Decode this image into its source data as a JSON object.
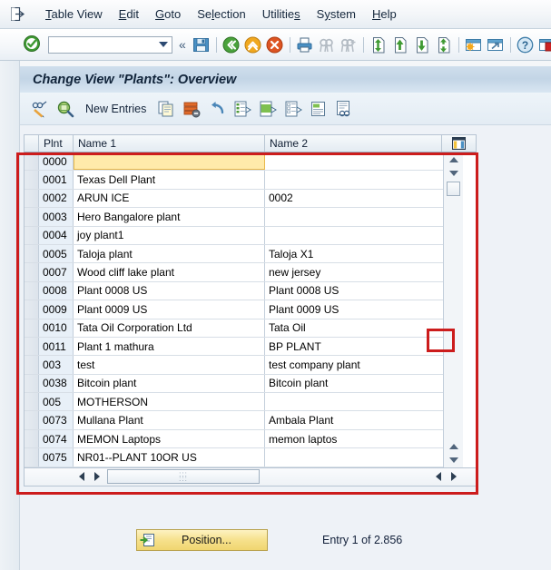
{
  "menu": {
    "system_icon": "window-system-menu-icon",
    "items": [
      {
        "label": "Table View",
        "accel": "T",
        "name": "menu-table-view"
      },
      {
        "label": "Edit",
        "accel": "E",
        "name": "menu-edit"
      },
      {
        "label": "Goto",
        "accel": "G",
        "name": "menu-goto"
      },
      {
        "label": "Selection",
        "accel": "l",
        "name": "menu-selection"
      },
      {
        "label": "Utilities",
        "accel": "s",
        "name": "menu-utilities"
      },
      {
        "label": "System",
        "accel": "y",
        "name": "menu-system"
      },
      {
        "label": "Help",
        "accel": "H",
        "name": "menu-help"
      }
    ]
  },
  "toolbar": {
    "enter_icon": "enter-check-icon",
    "command_field_value": "",
    "command_field_placeholder": "",
    "expand_icon": "expand-command-field-icon",
    "buttons": [
      {
        "name": "save-icon",
        "title": "Save"
      },
      {
        "name": "back-icon",
        "title": "Back"
      },
      {
        "name": "exit-icon",
        "title": "Exit"
      },
      {
        "name": "cancel-icon",
        "title": "Cancel"
      },
      {
        "name": "print-icon",
        "title": "Print"
      },
      {
        "name": "find-icon",
        "title": "Find"
      },
      {
        "name": "find-next-icon",
        "title": "Find Next"
      },
      {
        "name": "first-page-icon",
        "title": "First Page"
      },
      {
        "name": "previous-page-icon",
        "title": "Previous Page"
      },
      {
        "name": "next-page-icon",
        "title": "Next Page"
      },
      {
        "name": "last-page-icon",
        "title": "Last Page"
      },
      {
        "name": "create-session-icon",
        "title": "Create New Session"
      },
      {
        "name": "create-shortcut-icon",
        "title": "Create Shortcut"
      },
      {
        "name": "help-icon",
        "title": "Help"
      },
      {
        "name": "customize-layout-icon",
        "title": "Customize Local Layout"
      }
    ]
  },
  "title": "Change View \"Plants\": Overview",
  "app_toolbar": {
    "new_entries_label": "New Entries",
    "buttons": [
      {
        "name": "display-change-icon",
        "title": "Display/Change"
      },
      {
        "name": "details-magnifier-icon",
        "title": "Details"
      },
      {
        "name": "copy-as-icon",
        "title": "Copy As..."
      },
      {
        "name": "delete-row-icon",
        "title": "Delete"
      },
      {
        "name": "undo-icon",
        "title": "Undo Change"
      },
      {
        "name": "select-all-icon",
        "title": "Select All"
      },
      {
        "name": "select-block-icon",
        "title": "Select Block"
      },
      {
        "name": "deselect-all-icon",
        "title": "Deselect All"
      },
      {
        "name": "variable-list-icon",
        "title": "Variable List"
      },
      {
        "name": "display-detail-icon",
        "title": "Display Detail"
      }
    ]
  },
  "grid": {
    "columns": [
      {
        "key": "plnt",
        "label": "Plnt"
      },
      {
        "key": "name1",
        "label": "Name 1"
      },
      {
        "key": "name2",
        "label": "Name 2"
      }
    ],
    "config_icon": "table-settings-icon",
    "rows": [
      {
        "plnt": "0000",
        "name1": "",
        "name2": "",
        "selected": true
      },
      {
        "plnt": "0001",
        "name1": "Texas Dell Plant",
        "name2": ""
      },
      {
        "plnt": "0002",
        "name1": "ARUN ICE",
        "name2": "0002"
      },
      {
        "plnt": "0003",
        "name1": "Hero Bangalore plant",
        "name2": ""
      },
      {
        "plnt": "0004",
        "name1": "joy plant1",
        "name2": ""
      },
      {
        "plnt": "0005",
        "name1": "Taloja plant",
        "name2": "Taloja X1"
      },
      {
        "plnt": "0007",
        "name1": "Wood cliff lake plant",
        "name2": "new jersey"
      },
      {
        "plnt": "0008",
        "name1": "Plant 0008 US",
        "name2": "Plant 0008 US"
      },
      {
        "plnt": "0009",
        "name1": "Plant 0009 US",
        "name2": "Plant 0009 US"
      },
      {
        "plnt": "0010",
        "name1": "Tata Oil Corporation Ltd",
        "name2": "Tata Oil"
      },
      {
        "plnt": "0011",
        "name1": "Plant 1 mathura",
        "name2": "BP PLANT"
      },
      {
        "plnt": "003",
        "name1": "test",
        "name2": "test company plant"
      },
      {
        "plnt": "0038",
        "name1": "Bitcoin plant",
        "name2": "Bitcoin plant"
      },
      {
        "plnt": "005",
        "name1": "MOTHERSON",
        "name2": ""
      },
      {
        "plnt": "0073",
        "name1": "Mullana Plant",
        "name2": "Ambala Plant"
      },
      {
        "plnt": "0074",
        "name1": "MEMON Laptops",
        "name2": "memon laptos"
      },
      {
        "plnt": "0075",
        "name1": "NR01--PLANT 10OR US",
        "name2": ""
      }
    ],
    "vscroll": {
      "up_icon": "scroll-up-icon",
      "down_icon": "scroll-down-icon",
      "page_up_icon": "scroll-page-up-icon",
      "page_down_icon": "scroll-page-down-icon"
    },
    "hscroll": {
      "left_icon": "scroll-left-icon",
      "right_icon": "scroll-right-icon"
    }
  },
  "footer": {
    "position_button_label": "Position...",
    "position_button_icon": "position-arrow-icon",
    "entry_status": "Entry 1 of 2.856"
  },
  "colors": {
    "annotation": "#cc1c1c",
    "selected_cell": "#ffeaaa",
    "key_column": "#e8f0f8",
    "title_bar": "#c3d5e6",
    "button_yellow": "#f6e18c"
  }
}
